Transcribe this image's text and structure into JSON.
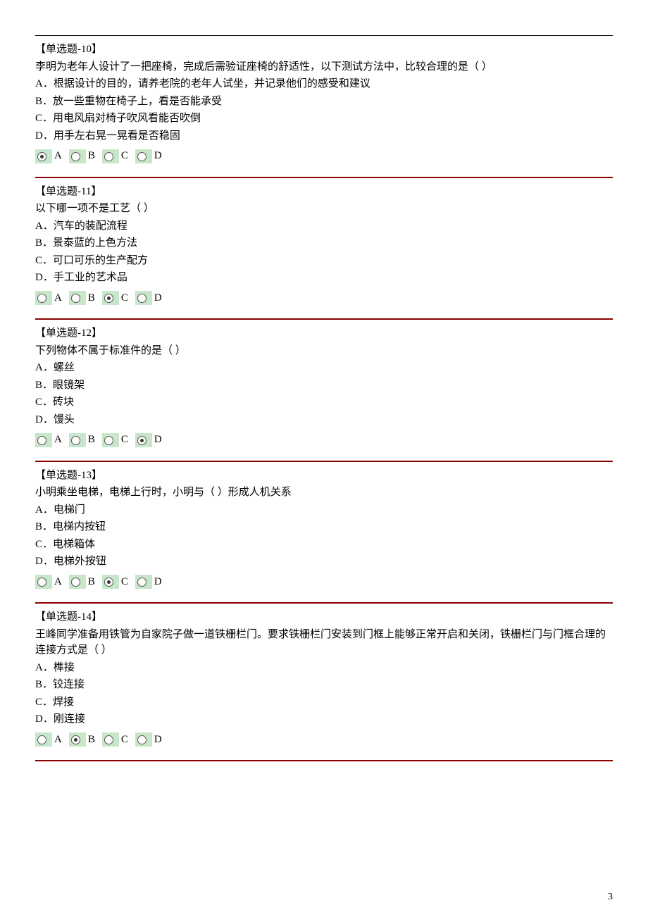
{
  "pageNumber": "3",
  "questions": [
    {
      "title": "【单选题-10】",
      "stem": "李明为老年人设计了一把座椅，完成后需验证座椅的舒适性，以下测试方法中，比较合理的是（ ）",
      "options": [
        "A．根据设计的目的，请养老院的老年人试坐，并记录他们的感受和建议",
        "B．放一些重物在椅子上，看是否能承受",
        "C．用电风扇对椅子吹风看能否吹倒",
        "D．用手左右晃一晃看是否稳固"
      ],
      "choices": [
        "A",
        "B",
        "C",
        "D"
      ],
      "selected": 0
    },
    {
      "title": "【单选题-11】",
      "stem": "以下哪一项不是工艺（ ）",
      "options": [
        "A．汽车的装配流程",
        "B．景泰蓝的上色方法",
        "C．可口可乐的生产配方",
        "D．手工业的艺术品"
      ],
      "choices": [
        "A",
        "B",
        "C",
        "D"
      ],
      "selected": 2
    },
    {
      "title": "【单选题-12】",
      "stem": "下列物体不属于标准件的是（ ）",
      "options": [
        "A．螺丝",
        "B．眼镜架",
        "C．砖块",
        "D．馒头"
      ],
      "choices": [
        "A",
        "B",
        "C",
        "D"
      ],
      "selected": 3
    },
    {
      "title": "【单选题-13】",
      "stem": "小明乘坐电梯，电梯上行时，小明与（ ）形成人机关系",
      "options": [
        "A．电梯门",
        "B．电梯内按钮",
        "C．电梯箱体",
        "D．电梯外按钮"
      ],
      "choices": [
        "A",
        "B",
        "C",
        "D"
      ],
      "selected": 2
    },
    {
      "title": "【单选题-14】",
      "stem": "王峰同学准备用铁管为自家院子做一道铁栅栏门。要求铁栅栏门安装到门框上能够正常开启和关闭，铁栅栏门与门框合理的连接方式是（ ）",
      "options": [
        "A．榫接",
        "B．铰连接",
        "C．焊接",
        "D．刚连接"
      ],
      "choices": [
        "A",
        "B",
        "C",
        "D"
      ],
      "selected": 1
    }
  ]
}
